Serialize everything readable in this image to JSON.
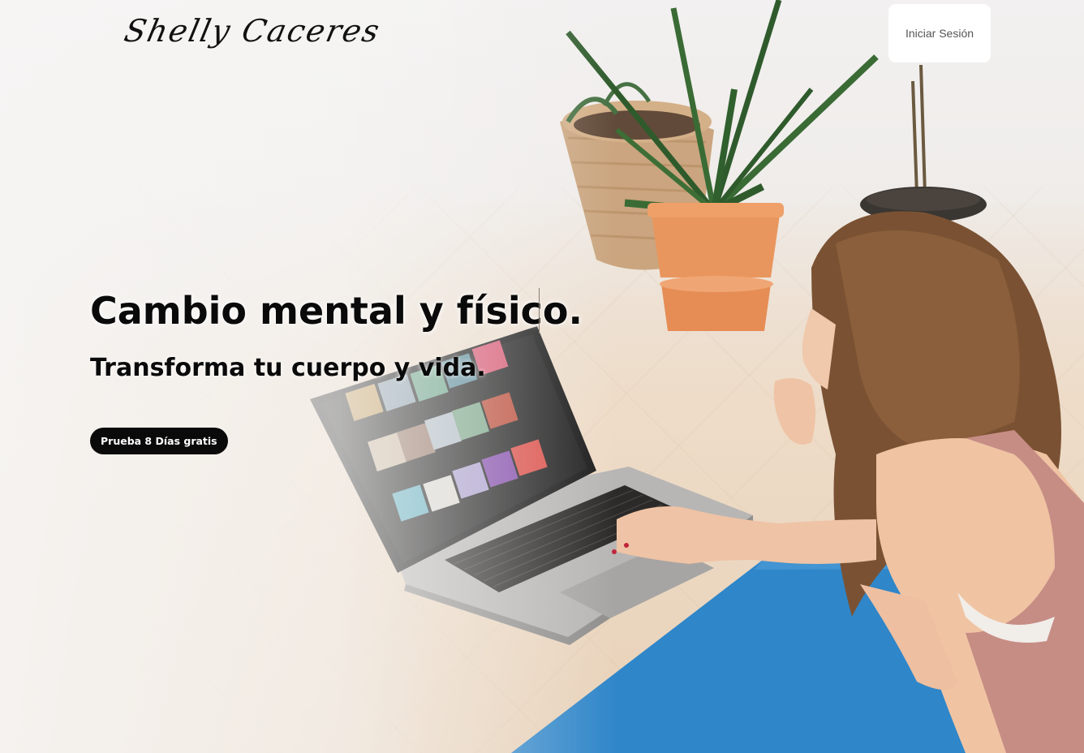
{
  "header": {
    "logo_text": "Shelly Caceres",
    "login_label": "Iniciar Sesión"
  },
  "hero": {
    "headline": "Cambio mental y físico.",
    "subheadline": "Transforma tu cuerpo y vida.",
    "cta_label": "Prueba 8 Días gratis"
  },
  "colors": {
    "cta_background": "#0a0a0a",
    "cta_text": "#ffffff",
    "login_background": "#ffffff",
    "headline_text": "#0a0a0a",
    "mat_blue": "#2f86c9",
    "pot_terracotta": "#e9965e"
  }
}
